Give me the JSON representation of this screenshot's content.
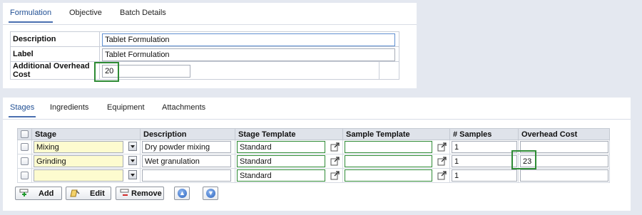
{
  "top_tabs": [
    {
      "label": "Formulation",
      "active": true
    },
    {
      "label": "Objective",
      "active": false
    },
    {
      "label": "Batch Details",
      "active": false
    }
  ],
  "formulation": {
    "description_label": "Description",
    "description_value": "Tablet Formulation",
    "label_label": "Label",
    "label_value": "Tablet Formulation",
    "overhead_label": "Additional Overhead Cost",
    "overhead_value": "20"
  },
  "bottom_tabs": [
    {
      "label": "Stages",
      "active": true
    },
    {
      "label": "Ingredients",
      "active": false
    },
    {
      "label": "Equipment",
      "active": false
    },
    {
      "label": "Attachments",
      "active": false
    }
  ],
  "grid": {
    "columns": [
      "Stage",
      "Description",
      "Stage Template",
      "Sample Template",
      "# Samples",
      "Overhead Cost"
    ],
    "rows": [
      {
        "stage": "Mixing",
        "description": "Dry powder mixing",
        "stage_template": "Standard",
        "sample_template": "",
        "samples": "1",
        "overhead": ""
      },
      {
        "stage": "Grinding",
        "description": "Wet granulation",
        "stage_template": "Standard",
        "sample_template": "",
        "samples": "1",
        "overhead": "23"
      },
      {
        "stage": "",
        "description": "",
        "stage_template": "Standard",
        "sample_template": "",
        "samples": "1",
        "overhead": ""
      }
    ]
  },
  "buttons": {
    "add": "Add",
    "edit": "Edit",
    "remove": "Remove",
    "up_icon": "arrow-up-icon",
    "down_icon": "arrow-down-icon"
  },
  "colors": {
    "accent": "#1f4e93",
    "highlight": "#2e8b35",
    "stage_field": "#fdfbcf"
  }
}
